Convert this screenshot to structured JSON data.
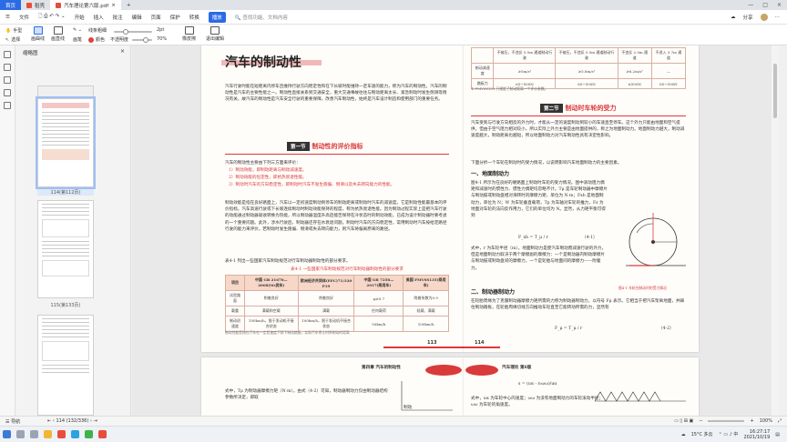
{
  "tabs": {
    "home": "首页",
    "second": "稻壳",
    "doc": "汽车理论第六版.pdf"
  },
  "menu": {
    "file": "文件",
    "items": [
      "开始",
      "插入",
      "批注",
      "编辑",
      "页面",
      "保护",
      "转换"
    ],
    "highlight": "播放",
    "search_placeholder": "查找功能、文档内容",
    "right": [
      "分享"
    ]
  },
  "toolbar": {
    "hand": "手型",
    "select": "选择",
    "draw_curve": "画曲线",
    "draw_line": "画直线",
    "pen": "画笔",
    "line_thickness": "线条粗细",
    "thickness_value": "2pt",
    "color": "颜色",
    "opacity": "不透明度",
    "opacity_value": "70%",
    "eraser": "橡皮擦",
    "exit": "退出编辑",
    "thickness_level": 0.3,
    "opacity_level": 0.7
  },
  "thumbnails": {
    "title": "缩略图",
    "labels": [
      "114(第112页)",
      "115(第133页)"
    ]
  },
  "page_left": {
    "title": "汽车的制动性",
    "intro": "汽车行驶时能在短距离内停车且维持行驶方向稳定性和在下长坡时能维持一定车速的能力，称为汽车的制动性。汽车的制动性是汽车的主要性能之一。制动性直接关系到交通安全，重大交通事故往往与制动距离太长、紧急制动时发生侧滑等情况有关，故汽车的制动性是汽车安全行驶的重要保障。改善汽车制动性，始终是汽车设计制造和使用部门的重要任务。",
    "section_tag": "第一节",
    "section_title": "制动性的评价指标",
    "list_intro": "汽车的制动性主要由下列三方面来评价：",
    "list": [
      "1）制动效能，即制动距离与制动减速度。",
      "2）制动效能的恒定性，即抗热衰退性能。",
      "3）制动时汽车的方向稳定性，即制动时汽车不发生跑偏、侧滑以及失去转向能力的性能。"
    ],
    "para2": "制动效能是指在良好路面上，汽车以一定初速度制动到停车的制动距离或制动时汽车的减速度。它是制动性能最基本的评价指标。汽车高速行驶或下长坡连续制动时制动效能保持的程度，称为抗热衰退性能。因为制动过程实际上是把汽车行驶的动能通过制动器吸收转换为热能，所以制动器温度升高后能否保持在冷状态时的制动效能，已成为设计制动器时要考虑的一个重要问题。此外，涉水行驶后，制动器还存在水衰退问题。制动时汽车的方向稳定性，常用制动时汽车按给定路径行驶的能力来评价。若制动时发生跑偏、侧滑或失去转向能力，则汽车将偏离原来的路径。",
    "para3": "表4-1 列出一些国家汽车制动规范对行车制动器制动性的部分要求。",
    "table_caption": "表4-1  一些国家汽车制动规范对行车制动器制动性的部分要求",
    "table_header": [
      "项目",
      "中国 GB 21670—2008(M₁类车)",
      "欧洲经济共同体(EEC)71/320 P19",
      "中国 GB 7258—2017(乘用车)",
      "美国 FMVSS135(乘用车)"
    ],
    "table_rows": [
      [
        "试验路面",
        "附着良好",
        "附着良好",
        "φ≥0.7",
        "附着系数为0.9"
      ],
      [
        "载重",
        "满载和空载",
        "满载",
        "任何载荷",
        "轻载、满载"
      ],
      [
        "制动初速度",
        "100km/h，限于发动机不接合状态",
        "100km/h，限于发动机不接合状态",
        "50km/h",
        "100km/h"
      ]
    ],
    "footnote": "制动性能是指在汽车在一定初速度下踩下制动踏板，实际汽车停止时所制动的距离",
    "page_number": "113"
  },
  "page_right": {
    "top_table": [
      [
        "",
        "不被压，不违反 5.5m 通道制动行驶",
        "不被压，不违反 5.5m 通道制动行驶",
        "不违反 2.5m 通道",
        "不进入 3.7m 通道"
      ],
      [
        "制动减速度",
        "≥5m/s²",
        "≥5.8m/s²",
        "≥6.2m/s²",
        "—"
      ],
      [
        "踏板力",
        "65~500N",
        "65~500N",
        "≤500N",
        "65~500N"
      ]
    ],
    "top_note": "① FMVSS135 只规定了制动距离一个评价参数。",
    "section_tag": "第二节",
    "section_title": "制动时车轮的受力",
    "intro": "汽车受到与行驶方向相反的外力时，才能从一定的速度制动到较小的车速直至停车。这个外力只能由地面和空气提供，但由于空气阻力相对较小，所以实际上外力主要是由地面提供的，称之为地面制动力。地面制动力越大，制动减速度越大，制动距离也越短，所以地面制动力对汽车制动性具有决定性影响。",
    "intro2": "下面分析一个车轮在制动时的受力情况，以说明影响汽车地面制动力的主要因素。",
    "sub1": "一、地面制动力",
    "para1": "图4-1 所示为在良好的硬路面上制动时车轮的受力情况。图中滚动阻力偶矩和减速时的惯性力、惯性力偶矩均忽略不计。Tμ 是车轮制动器中摩擦片与制动鼓或制动盘相对滑转时的摩擦力矩，单位为 N·m；Fxb 是地面制动力，单位为 N；W 为车轮垂直载荷，Tp 为车轴对车轮的推力，Fz 为地面对车轮的法向反作用力，它们的单位均为 N。显然，从力矩平衡可得到",
    "formula": "F_xb = T_μ / r",
    "eq_no": "（4-1）",
    "para2": "式中，r 为车轮半径（m）。地面制动力是使汽车制动而减速行驶的外力，但是地面制动力取决于两个摩擦副的摩擦力：一个是制动器内制动摩擦片与制动鼓或制动盘间的摩擦力，一个是轮胎与地面间的摩擦力——附着力。",
    "sub2": "二、制动器制动力",
    "para3": "在轮胎周缘为了克服制动器摩擦力矩所需的力称为制动器制动力，以符号 Fμ 表示。它相当于把汽车架离地面，并踩住制动踏板，在轮胎周缘切线方向推动车轮直至它能转动所需的力，显然有",
    "formula2": "F_μ = T_μ / r",
    "eq_no2": "（4-2）",
    "fig_caption": "图4-1  车轮在制动时的受力情况",
    "page_number": "114"
  },
  "lower_pages": {
    "left_text": "式中，Tμ 为制动器摩擦力矩（N·m）。由式（4-2）可知，制动器制动力仅由制动器结构参数所决定，即取",
    "chapter": "第四章  汽车的制动性",
    "right_header": "汽车理论  第6版",
    "fig_label": "制动",
    "right_text": "式中，uα 为车轮中心的速度；ωω 为没有地面制动力的车轮滚动半径；ωω 为车轮的角速度。",
    "right_formula": "s = (uα - r₀ωω)/uα"
  },
  "statusbar": {
    "nav": "导航",
    "page": "114 (132/336)",
    "zoom": "100%"
  },
  "taskbar": {
    "weather": "15°C 多云",
    "time": "16:27:17",
    "date": "2021/10/19"
  }
}
